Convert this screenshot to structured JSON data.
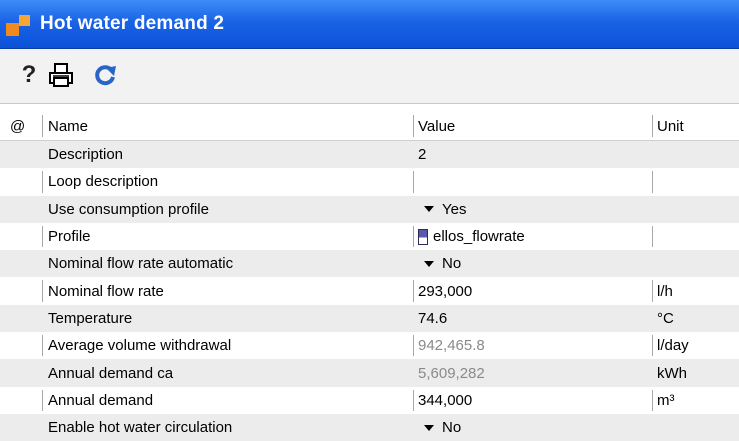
{
  "window": {
    "title": "Hot water demand 2"
  },
  "toolbar": {
    "help_label": "?",
    "icons": [
      "help-icon",
      "print-icon",
      "refresh-icon"
    ]
  },
  "table": {
    "headers": {
      "at": "@",
      "name": "Name",
      "value": "Value",
      "unit": "Unit"
    },
    "rows": [
      {
        "name": "Description",
        "value": "2",
        "unit": ""
      },
      {
        "name": "Loop description",
        "value": "",
        "unit": ""
      },
      {
        "name": "Use consumption profile",
        "value": "Yes",
        "unit": ""
      },
      {
        "name": "Profile",
        "value": "ellos_flowrate",
        "unit": ""
      },
      {
        "name": "Nominal flow rate automatic",
        "value": "No",
        "unit": ""
      },
      {
        "name": "Nominal flow rate",
        "value": "293,000",
        "unit": "l/h"
      },
      {
        "name": "Temperature",
        "value": "74.6",
        "unit": "°C"
      },
      {
        "name": "Average volume withdrawal",
        "value": "942,465.8",
        "unit": "l/day"
      },
      {
        "name": "Annual demand ca",
        "value": "5,609,282",
        "unit": "kWh"
      },
      {
        "name": "Annual demand",
        "value": "344,000",
        "unit": "m³"
      },
      {
        "name": "Enable hot water circulation",
        "value": "No",
        "unit": ""
      }
    ]
  },
  "colors": {
    "titlebar": "#1a63e6",
    "row_shade": "#ececec",
    "disabled_text": "#8a8a8a"
  }
}
